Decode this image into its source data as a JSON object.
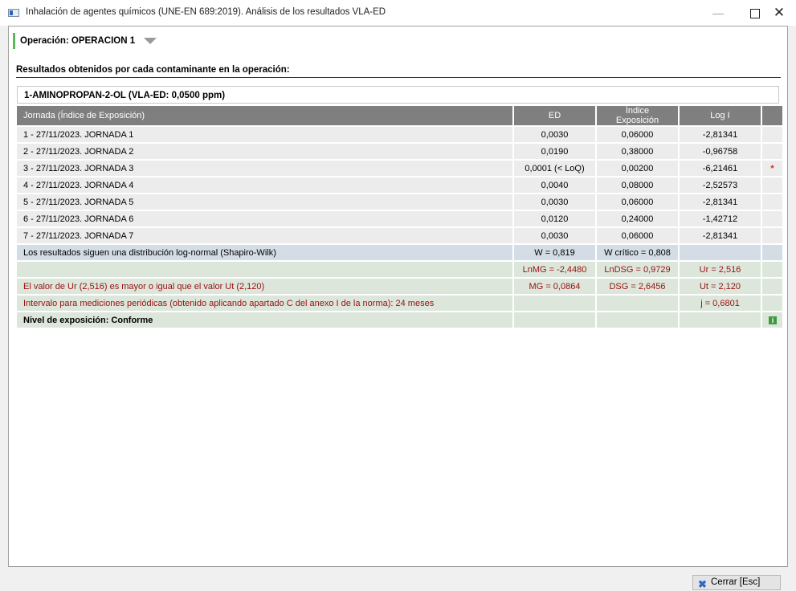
{
  "window": {
    "title": "Inhalación de agentes químicos (UNE-EN 689:2019). Análisis de los resultados VLA-ED",
    "minimize_glyph": "—",
    "close_glyph": "✕"
  },
  "operation": {
    "label": "Operación: OPERACION 1"
  },
  "results_title": "Resultados obtenidos por cada contaminante en la operación:",
  "contaminant": {
    "header": "1-AMINOPROPAN-2-OL (VLA-ED: 0,0500 ppm)"
  },
  "table": {
    "columns": [
      "Jornada (Índice de Exposición)",
      "ED",
      "Índice Exposición",
      "Log I",
      ""
    ],
    "rows": [
      {
        "jornada": "1 - 27/11/2023. JORNADA 1",
        "ed": "0,0030",
        "indice": "0,06000",
        "log": "-2,81341",
        "mark": ""
      },
      {
        "jornada": "2 - 27/11/2023. JORNADA 2",
        "ed": "0,0190",
        "indice": "0,38000",
        "log": "-0,96758",
        "mark": ""
      },
      {
        "jornada": "3 - 27/11/2023. JORNADA 3",
        "ed": "0,0001 (< LoQ)",
        "indice": "0,00200",
        "log": "-6,21461",
        "mark": "*"
      },
      {
        "jornada": "4 - 27/11/2023. JORNADA 4",
        "ed": "0,0040",
        "indice": "0,08000",
        "log": "-2,52573",
        "mark": ""
      },
      {
        "jornada": "5 - 27/11/2023. JORNADA 5",
        "ed": "0,0030",
        "indice": "0,06000",
        "log": "-2,81341",
        "mark": ""
      },
      {
        "jornada": "6 - 27/11/2023. JORNADA 6",
        "ed": "0,0120",
        "indice": "0,24000",
        "log": "-1,42712",
        "mark": ""
      },
      {
        "jornada": "7 - 27/11/2023. JORNADA 7",
        "ed": "0,0030",
        "indice": "0,06000",
        "log": "-2,81341",
        "mark": ""
      }
    ],
    "summary": {
      "shapiro": {
        "text": "Los resultados siguen una distribución log-normal (Shapiro-Wilk)",
        "w": "W = 0,819",
        "w_critico": "W crítico = 0,808"
      },
      "ln": {
        "lnmg": "LnMG = -2,4480",
        "lndsg": "LnDSG = 0,9729",
        "ur": "Ur = 2,516"
      },
      "comparison": {
        "text": "El valor de Ur (2,516) es mayor o igual que el valor Ut (2,120)",
        "mg": "MG = 0,0864",
        "dsg": "DSG = 2,6456",
        "ut": "Ut = 2,120"
      },
      "interval": {
        "text": "Intervalo para mediciones periódicas (obtenido aplicando apartado C del anexo I de la norma): 24 meses",
        "j": "j = 0,6801"
      },
      "level": {
        "text": "Nivel de exposición: Conforme",
        "icon": "i"
      }
    }
  },
  "footer": {
    "close_label": "Cerrar [Esc]"
  },
  "colors": {
    "header_gray": "#7f7f7f",
    "shapiro_blue": "#d4dde6",
    "summary_green": "#dce6da",
    "accent_green": "#5cb85c",
    "text_red": "#9a1010"
  }
}
